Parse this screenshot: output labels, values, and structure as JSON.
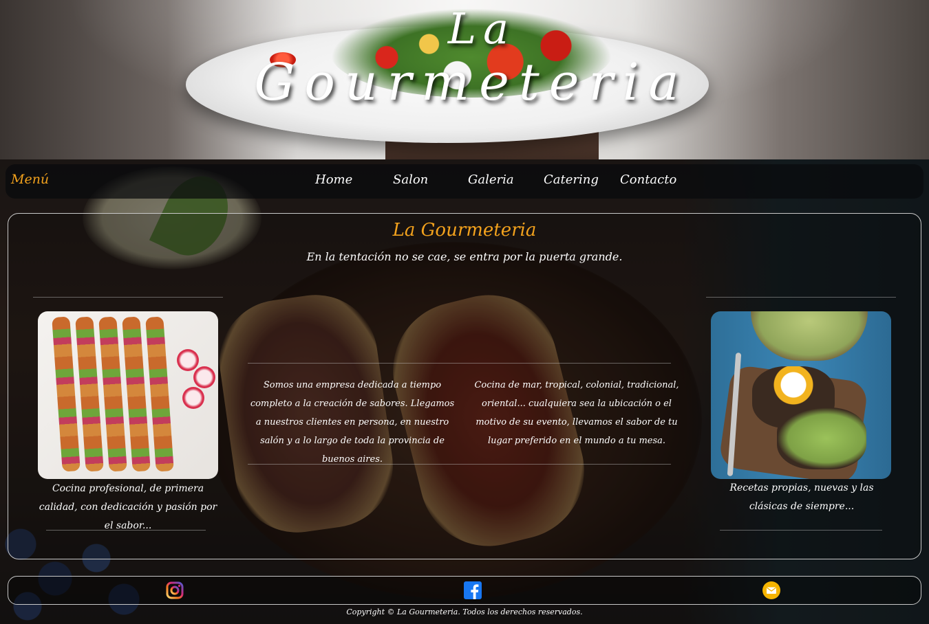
{
  "hero": {
    "title_line1": "La",
    "title_line2": "Gourmeteria"
  },
  "nav": {
    "menu_label": "Menú",
    "links": [
      "Home",
      "Salon",
      "Galeria",
      "Catering",
      "Contacto"
    ]
  },
  "main": {
    "brand": "La Gourmeteria",
    "slogan": "En la tentación no se cae, se entra por la puerta grande.",
    "left_caption": "Cocina profesional, de primera calidad, con dedicación y pasión por el sabor...",
    "center_text_1": "Somos una empresa dedicada a tiempo completo a la creación de sabores. Llegamos a nuestros clientes en persona, en nuestro salón y a lo largo de toda la provincia de buenos aires.",
    "center_text_2": "Cocina de mar, tropical, colonial, tradicional, oriental... cualquiera sea la ubicación o el motivo de su evento, llevamos el sabor de tu lugar preferido en el mundo a tu mesa.",
    "right_caption": "Recetas propias, nuevas y las clásicas de siempre..."
  },
  "footer": {
    "icons": [
      "instagram-icon",
      "facebook-icon",
      "email-icon"
    ],
    "copyright": "Copyright © La Gourmeteria. Todos los derechos reservados."
  },
  "colors": {
    "accent": "#f3a21d",
    "text": "#ffffff",
    "facebook": "#1877f2",
    "email": "#f5b400"
  }
}
